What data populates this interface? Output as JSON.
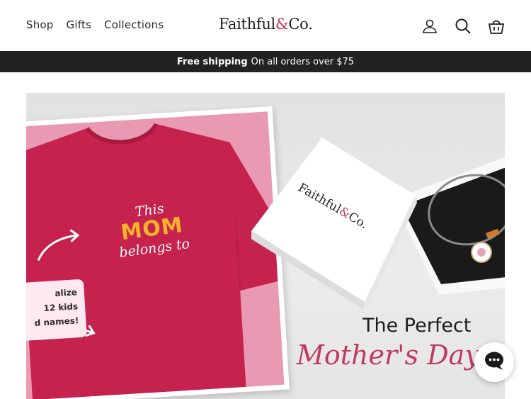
{
  "header": {
    "nav": [
      {
        "label": "Shop"
      },
      {
        "label": "Gifts"
      },
      {
        "label": "Collections"
      }
    ],
    "logo": {
      "part1": "Faithful",
      "amp": "&",
      "part2": "Co."
    },
    "icons": [
      "account-icon",
      "search-icon",
      "cart-icon"
    ]
  },
  "banner": {
    "bold": "Free shipping",
    "text": "On all orders over $75"
  },
  "hero": {
    "shirt": {
      "line1": "This",
      "line2": "MOM",
      "line3": "belongs to"
    },
    "callout": {
      "line1": "alize",
      "line2": "12 kids",
      "line3": "d names!"
    },
    "box_logo": {
      "part1": "Faithful",
      "amp": "&",
      "part2": "Co."
    },
    "headline1": "The Perfect",
    "headline2": "Mother's Day"
  },
  "colors": {
    "brand_accent": "#c2335d",
    "banner_bg": "#222222",
    "shirt": "#c5224e",
    "mom_yellow": "#f7b22a"
  }
}
